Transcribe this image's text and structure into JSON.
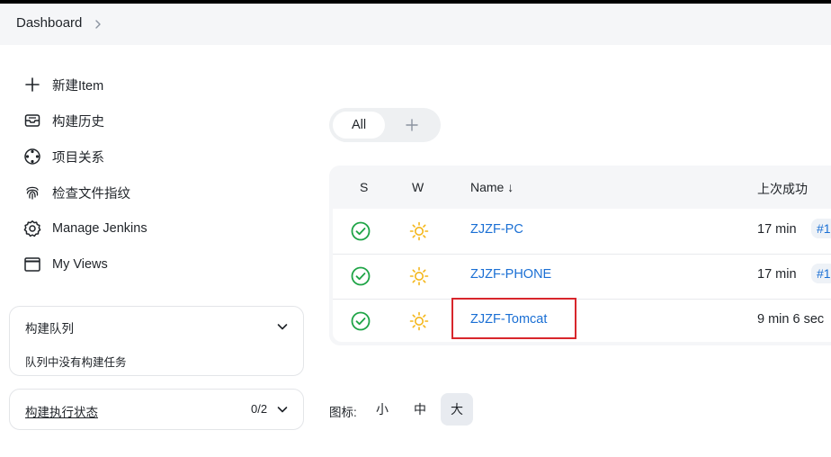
{
  "breadcrumb": {
    "dashboard": "Dashboard"
  },
  "sidebar": {
    "items": [
      {
        "label": "新建Item",
        "icon": "plus-icon"
      },
      {
        "label": "构建历史",
        "icon": "inbox-icon"
      },
      {
        "label": "项目关系",
        "icon": "relation-icon"
      },
      {
        "label": "检查文件指纹",
        "icon": "fingerprint-icon"
      },
      {
        "label": "Manage Jenkins",
        "icon": "gear-icon"
      },
      {
        "label": "My Views",
        "icon": "window-icon"
      }
    ]
  },
  "queue": {
    "title": "构建队列",
    "empty": "队列中没有构建任务"
  },
  "executors": {
    "title": "构建执行状态",
    "count": "0/2"
  },
  "tabs": {
    "all": "All",
    "add": "+"
  },
  "table": {
    "headers": {
      "s": "S",
      "w": "W",
      "name": "Name ↓",
      "last_success": "上次成功"
    },
    "rows": [
      {
        "name": "ZJZF-PC",
        "last_success": "17 min",
        "build": "#1",
        "status": "success",
        "weather": "sunny"
      },
      {
        "name": "ZJZF-PHONE",
        "last_success": "17 min",
        "build": "#1",
        "status": "success",
        "weather": "sunny"
      },
      {
        "name": "ZJZF-Tomcat",
        "last_success": "9 min 6 sec",
        "build": "",
        "status": "success",
        "weather": "sunny"
      }
    ]
  },
  "icon_size": {
    "label": "图标:",
    "small": "小",
    "medium": "中",
    "large": "大",
    "selected": "large"
  },
  "colors": {
    "success": "#1ea446",
    "sunny": "#f4b619",
    "link": "#1a6fd4",
    "highlight": "#d8262c"
  }
}
